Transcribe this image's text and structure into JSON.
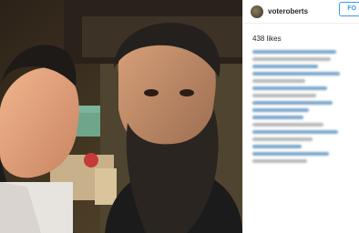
{
  "post": {
    "username": "voteroberts",
    "follow_label": "FO",
    "likes": "438 likes"
  },
  "colors": {
    "follow_blue": "#3897f0",
    "text": "#262626",
    "divider": "#efefef"
  },
  "icons": {
    "avatar": "user-avatar"
  }
}
